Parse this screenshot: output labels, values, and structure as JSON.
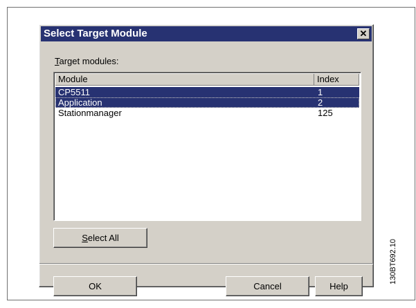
{
  "dialog": {
    "title": "Select Target Module",
    "close_label": "✕",
    "target_label": "Target modules:",
    "target_label_access": "T",
    "target_label_rest": "arget modules:"
  },
  "list": {
    "columns": [
      "Module",
      "Index"
    ],
    "rows": [
      {
        "module": "CP5511",
        "index": "1",
        "selected": true
      },
      {
        "module": "Application",
        "index": "2",
        "selected": true
      },
      {
        "module": "Stationmanager",
        "index": "125",
        "selected": false
      }
    ]
  },
  "buttons": {
    "select_all_access": "S",
    "select_all_rest": "elect All",
    "ok": "OK",
    "cancel": "Cancel",
    "help": "Help"
  },
  "side_code": "130BT692.10",
  "colors": {
    "titlebar": "#273272",
    "selection": "#273272",
    "dialog_face": "#d4d0c8"
  }
}
